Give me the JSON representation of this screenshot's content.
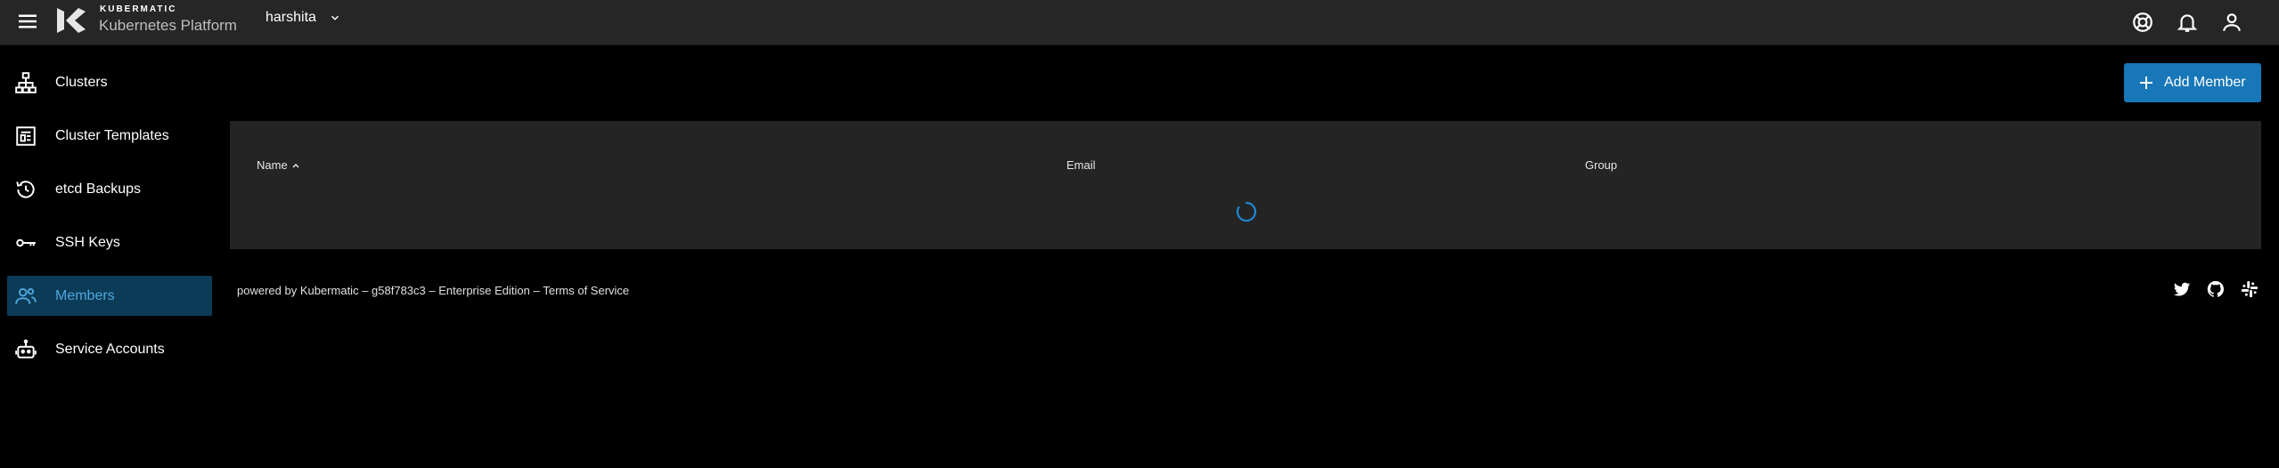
{
  "header": {
    "brand_small": "KUBERMATIC",
    "brand_big": "Kubernetes Platform",
    "project": "harshita",
    "icons": [
      "menu-icon",
      "help-icon",
      "notifications-bell-icon",
      "account-icon"
    ]
  },
  "sidebar": {
    "items": [
      {
        "label": "Clusters",
        "icon": "cluster-tree-icon"
      },
      {
        "label": "Cluster Templates",
        "icon": "template-icon"
      },
      {
        "label": "etcd Backups",
        "icon": "history-icon"
      },
      {
        "label": "SSH Keys",
        "icon": "key-icon"
      },
      {
        "label": "Members",
        "icon": "members-icon",
        "active": true
      },
      {
        "label": "Service Accounts",
        "icon": "robot-icon"
      }
    ]
  },
  "main": {
    "add_button": "Add Member",
    "table": {
      "columns": [
        "Name",
        "Email",
        "Group"
      ],
      "sort_indicator": "ascending"
    }
  },
  "footer": {
    "powered": "powered by Kubermatic",
    "version": "g58f783c3",
    "edition": "Enterprise Edition",
    "terms": "Terms of Service",
    "separator": " – ",
    "social_icons": [
      "twitter-icon",
      "github-icon",
      "slack-icon"
    ]
  },
  "colors": {
    "topbar": "#262626",
    "background": "#000000",
    "accent": "#1877b8",
    "active_bg": "#0b3b57",
    "active_text": "#4fa8dc",
    "card": "#242424"
  }
}
